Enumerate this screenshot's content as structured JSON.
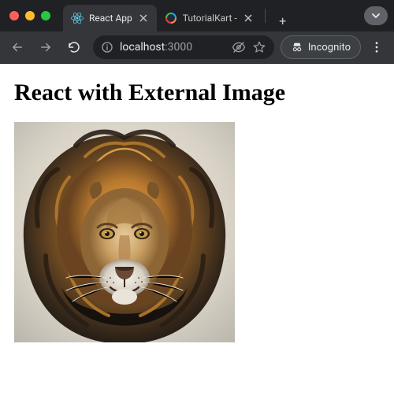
{
  "window": {
    "dropdown_glyph": "⌄"
  },
  "tabs": {
    "active": {
      "label": "React App",
      "favicon_name": "react-logo-icon"
    },
    "inactive": {
      "label": "TutorialKart -",
      "favicon_name": "tutorialkart-logo-icon"
    },
    "newtab_glyph": "+"
  },
  "toolbar": {
    "back_name": "back-icon",
    "forward_name": "forward-icon",
    "reload_name": "reload-icon",
    "info_name": "site-info-icon",
    "eye_name": "visibility-off-icon",
    "star_name": "bookmark-star-icon",
    "menu_name": "kebab-menu-icon"
  },
  "omnibox": {
    "host": "localhost",
    "path": ":3000"
  },
  "incognito": {
    "label": "Incognito",
    "icon_name": "incognito-icon"
  },
  "page": {
    "heading": "React with External Image",
    "image_alt": "lion"
  }
}
